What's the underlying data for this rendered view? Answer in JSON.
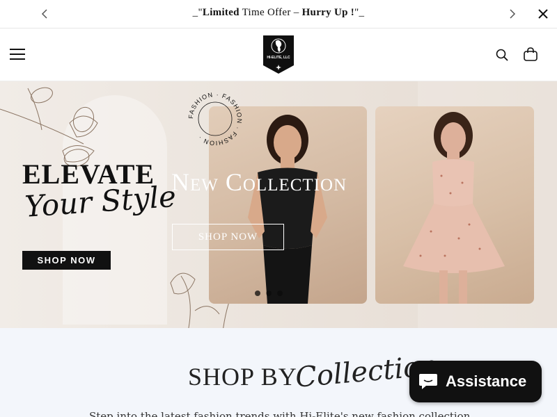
{
  "announcement": {
    "prefix": "_\"",
    "bold_1": "Limited",
    "middle": " Time Offer – ",
    "bold_2": "Hurry Up !",
    "suffix": "\"_"
  },
  "header": {
    "logo_text": "HI-ELITE, LLC",
    "icons": {
      "menu": "hamburger-menu-icon",
      "search": "search-icon",
      "cart": "cart-bag-icon"
    }
  },
  "hero": {
    "headline": "ELEVATE",
    "script_line": "Your Style",
    "cta_dark": "SHOP NOW",
    "badge_text": "FASHION · FASHION · FASHION ·",
    "title": "New Collection",
    "cta_outline": "SHOP NOW",
    "slides": {
      "total": 3,
      "active": 1
    }
  },
  "collection_section": {
    "title": "SHOP BY",
    "script": "Collection",
    "description": "Step into the latest fashion trends with Hi-Elite's new fashion collection"
  },
  "chat": {
    "label": "Assistance",
    "icon": "chat-bubble-icon"
  },
  "colors": {
    "dark": "#111111",
    "hero_bg": "#ece5de",
    "section_bg": "#f3f6fb"
  }
}
